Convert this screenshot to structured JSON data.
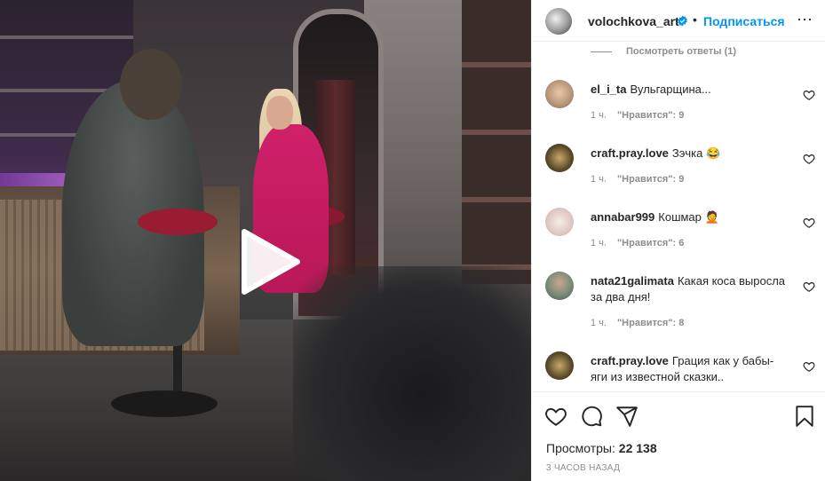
{
  "video": {
    "play_icon": "play-icon"
  },
  "header": {
    "username": "volochkova_art",
    "separator": "•",
    "follow_label": "Подписаться",
    "more_icon": "more-icon",
    "more_label": "⋯"
  },
  "view_replies": "Посмотреть ответы (1)",
  "comments": [
    {
      "username": "el_i_ta",
      "text": "Вульгарщина...",
      "time": "1 ч.",
      "likes": "\"Нравится\": 9",
      "avatar_color": "#c8b8a8"
    },
    {
      "username": "craft.pray.love",
      "text": "Зэчка 😂",
      "time": "1 ч.",
      "likes": "\"Нравится\": 9",
      "avatar_color": "#6a5a3a"
    },
    {
      "username": "annabar999",
      "text": "Кошмар 🤦",
      "time": "1 ч.",
      "likes": "\"Нравится\": 6",
      "avatar_color": "#e8d8d0"
    },
    {
      "username": "nata21galimata",
      "text": "Какая коса выросла за два дня!",
      "time": "1 ч.",
      "likes": "\"Нравится\": 8",
      "avatar_color": "#7a8a7a"
    },
    {
      "username": "craft.pray.love",
      "text": "Грация как у бабы-яги из известной сказки..",
      "time": "",
      "likes": "",
      "avatar_color": "#6a5a3a"
    }
  ],
  "actions": {
    "like_icon": "heart-icon",
    "comment_icon": "comment-icon",
    "share_icon": "share-icon",
    "save_icon": "bookmark-icon"
  },
  "views": {
    "label": "Просмотры:",
    "count": "22 138"
  },
  "time_ago": "3 ЧАСОВ НАЗАД"
}
